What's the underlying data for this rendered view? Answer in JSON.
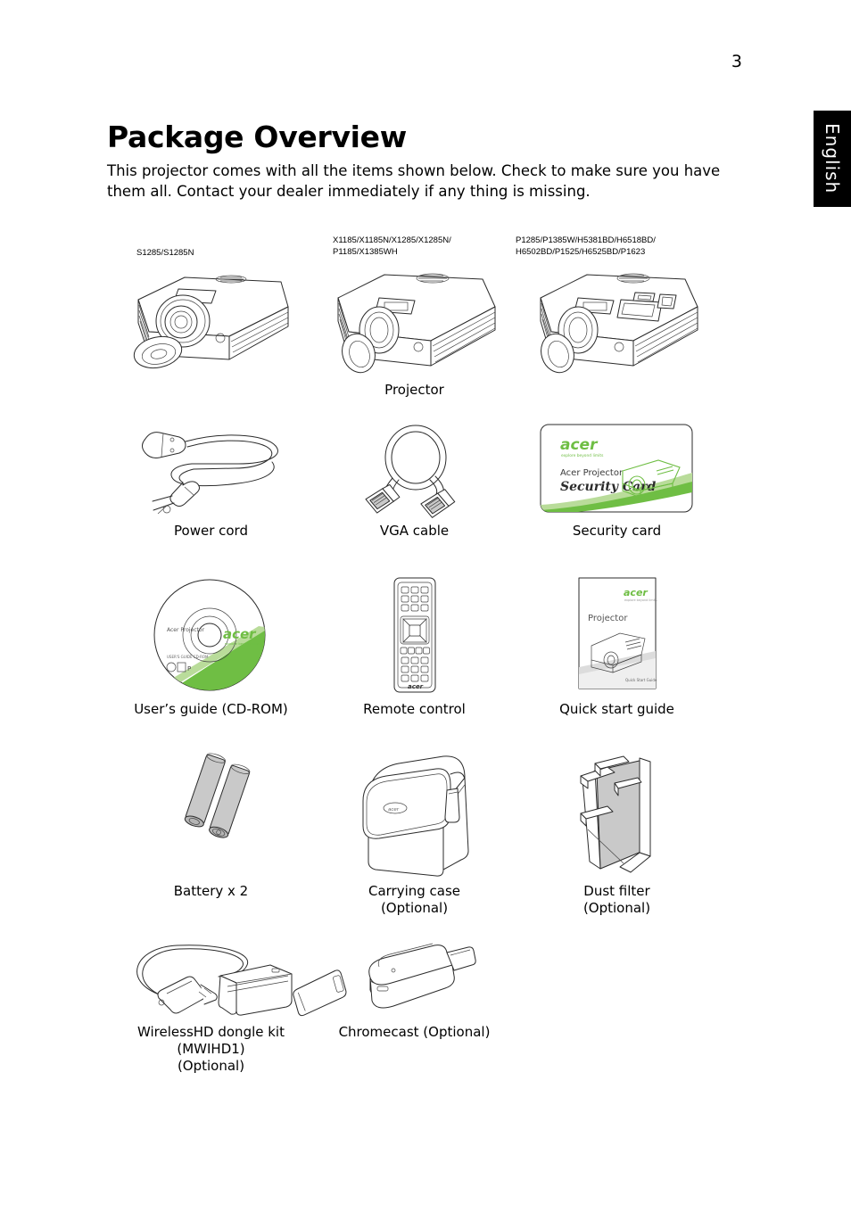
{
  "page": {
    "number": "3",
    "language_tab": "English",
    "title": "Package Overview",
    "intro": "This projector comes with all the items shown below. Check to make sure you have them all. Contact your dealer immediately if any thing is missing."
  },
  "model_labels": [
    "S1285/S1285N",
    "X1185/X1185N/X1285/X1285N/\nP1185/X1385WH",
    "P1285/P1385W/H5381BD/H6518BD/\nH6502BD/P1525/H6525BD/P1623"
  ],
  "items": {
    "projector": "Projector",
    "power_cord": "Power cord",
    "vga_cable": "VGA cable",
    "security_card": "Security card",
    "users_guide": "User’s guide (CD-ROM)",
    "remote_control": "Remote control",
    "quick_start_guide": "Quick start guide",
    "battery": "Battery x 2",
    "carrying_case": "Carrying case\n(Optional)",
    "dust_filter": "Dust filter\n(Optional)",
    "wirelesshd": "WirelessHD dongle kit\n(MWIHD1)\n(Optional)",
    "chromecast": "Chromecast (Optional)"
  },
  "artwork_text": {
    "security_card_brand": "acer",
    "security_card_tagline": "explore beyond limits",
    "security_card_line1": "Acer Projector",
    "security_card_line2": "Security Card",
    "cd_brand": "acer",
    "cd_title": "Acer Projector",
    "cd_subtitle": "USER'S GUIDE CD-ROM",
    "guide_brand": "acer",
    "guide_title": "Projector",
    "guide_footer": "Quick Start Guide",
    "remote_brand": "acer"
  },
  "colors": {
    "brand_green": "#6fbe44",
    "line": "#2b2b2b",
    "grey_fill": "#c9c9c9",
    "tab_background": "#000000"
  }
}
